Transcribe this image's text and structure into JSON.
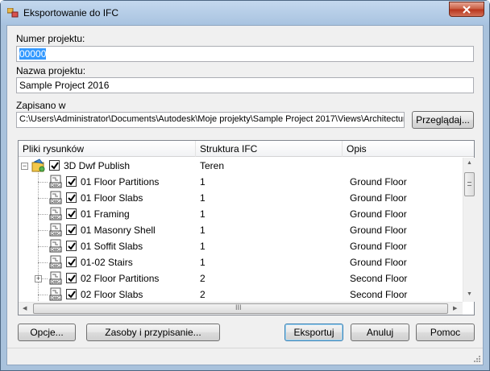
{
  "window": {
    "title": "Eksportowanie do IFC",
    "app_icon": "ifc-export-icon",
    "close_icon": "close-icon"
  },
  "form": {
    "project_number_label": "Numer projektu:",
    "project_number_value": "00000",
    "project_name_label": "Nazwa projektu:",
    "project_name_value": "Sample Project 2016",
    "saved_in_label": "Zapisano w",
    "saved_in_value": "C:\\Users\\Administrator\\Documents\\Autodesk\\Moje projekty\\Sample Project 2017\\Views\\Architectur",
    "browse_label": "Przeglądaj..."
  },
  "tree": {
    "columns": [
      "Pliki rysunków",
      "Struktura IFC",
      "Opis"
    ],
    "root": {
      "name": "3D Dwf Publish",
      "structure": "Teren",
      "description": "",
      "checked": true,
      "expander": "−"
    },
    "items": [
      {
        "name": "01 Floor Partitions",
        "structure": "1",
        "description": "Ground Floor",
        "checked": true,
        "expander": ""
      },
      {
        "name": "01 Floor Slabs",
        "structure": "1",
        "description": "Ground Floor",
        "checked": true,
        "expander": ""
      },
      {
        "name": "01 Framing",
        "structure": "1",
        "description": "Ground Floor",
        "checked": true,
        "expander": ""
      },
      {
        "name": "01 Masonry Shell",
        "structure": "1",
        "description": "Ground Floor",
        "checked": true,
        "expander": ""
      },
      {
        "name": "01 Soffit Slabs",
        "structure": "1",
        "description": "Ground Floor",
        "checked": true,
        "expander": ""
      },
      {
        "name": "01-02 Stairs",
        "structure": "1",
        "description": "Ground Floor",
        "checked": true,
        "expander": ""
      },
      {
        "name": "02 Floor Partitions",
        "structure": "2",
        "description": "Second Floor",
        "checked": true,
        "expander": "+"
      },
      {
        "name": "02 Floor Slabs",
        "structure": "2",
        "description": "Second Floor",
        "checked": true,
        "expander": ""
      }
    ],
    "hscroll_grip": "III"
  },
  "buttons": {
    "options": "Opcje...",
    "resources": "Zasoby i przypisanie...",
    "export": "Eksportuj",
    "cancel": "Anuluj",
    "help": "Pomoc"
  },
  "colors": {
    "titlebar": "#a8c3e0",
    "selection": "#3399ff",
    "close": "#c75a3e"
  }
}
